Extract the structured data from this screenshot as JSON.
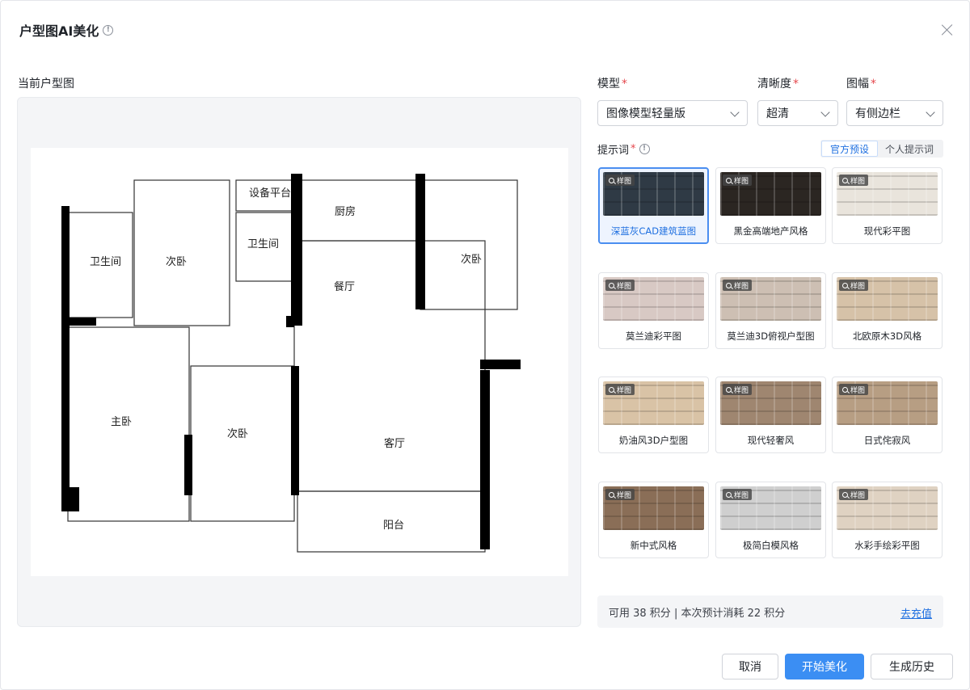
{
  "dialog": {
    "title": "户型图AI美化",
    "info_icon": "info-circle-icon",
    "close_icon": "close-icon"
  },
  "left": {
    "label": "当前户型图",
    "rooms": [
      "设备平台",
      "厨房",
      "卫生间",
      "次卧",
      "卫生间",
      "餐厅",
      "次卧",
      "主卧",
      "次卧",
      "客厅",
      "阳台"
    ]
  },
  "form": {
    "model": {
      "label": "模型",
      "value": "图像模型轻量版"
    },
    "clarity": {
      "label": "清晰度",
      "value": "超清"
    },
    "frame": {
      "label": "图幅",
      "value": "有侧边栏"
    },
    "required_mark": "*"
  },
  "prompt": {
    "label": "提示词",
    "tabs": [
      "官方预设",
      "个人提示词"
    ],
    "active_tab": "官方预设",
    "sample_tag": "样图",
    "presets": [
      {
        "name": "深蓝灰CAD建筑蓝图",
        "selected": true,
        "color": "#2f3a45"
      },
      {
        "name": "黑金高端地产风格",
        "selected": false,
        "color": "#2b2622"
      },
      {
        "name": "现代彩平图",
        "selected": false,
        "color": "#e9e4dc"
      },
      {
        "name": "莫兰迪彩平图",
        "selected": false,
        "color": "#d8c9c4"
      },
      {
        "name": "莫兰迪3D俯视户型图",
        "selected": false,
        "color": "#cdbfb3"
      },
      {
        "name": "北欧原木3D风格",
        "selected": false,
        "color": "#d6c2a8"
      },
      {
        "name": "奶油风3D户型图",
        "selected": false,
        "color": "#d9c3a6"
      },
      {
        "name": "现代轻奢风",
        "selected": false,
        "color": "#9f8670"
      },
      {
        "name": "日式侘寂风",
        "selected": false,
        "color": "#b79e83"
      },
      {
        "name": "新中式风格",
        "selected": false,
        "color": "#8a6e57"
      },
      {
        "name": "极简白模风格",
        "selected": false,
        "color": "#cfcfcf"
      },
      {
        "name": "水彩手绘彩平图",
        "selected": false,
        "color": "#dfd2c2"
      }
    ]
  },
  "credits": {
    "text": "可用 38 积分 | 本次预计消耗 22 积分",
    "recharge": "去充值"
  },
  "buttons": {
    "cancel": "取消",
    "start": "开始美化",
    "history": "生成历史"
  }
}
